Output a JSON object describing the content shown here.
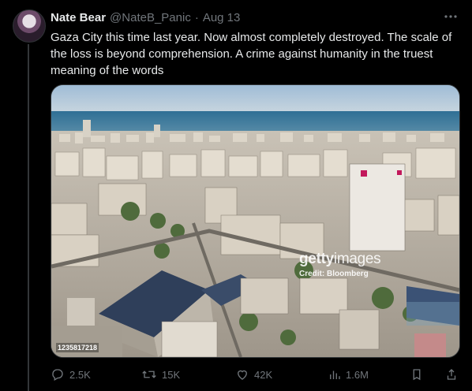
{
  "tweet": {
    "author_name": "Nate Bear",
    "handle": "@NateB_Panic",
    "separator": "·",
    "date": "Aug 13",
    "text": "Gaza City this time last year. Now almost completely destroyed. The scale of the loss is beyond comprehension. A crime against humanity in the truest meaning of the words",
    "more_icon": "more-horizontal-icon"
  },
  "media": {
    "watermark_brand_bold": "getty",
    "watermark_brand_light": "images",
    "credit": "Credit: Bloomberg",
    "image_id": "1235817218"
  },
  "actions": {
    "reply_count": "2.5K",
    "retweet_count": "15K",
    "like_count": "42K",
    "views_count": "1.6M"
  },
  "colors": {
    "background": "#000000",
    "text": "#e7e9ea",
    "muted": "#71767b",
    "border": "#2f3336"
  }
}
